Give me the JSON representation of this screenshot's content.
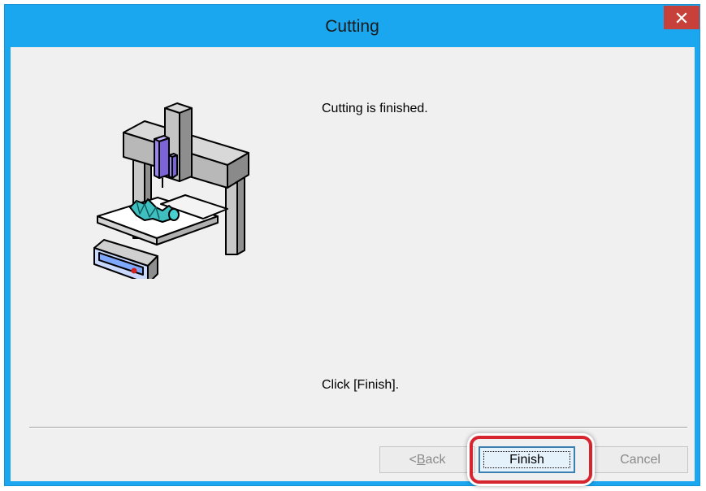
{
  "window": {
    "title": "Cutting",
    "close_label": "✕"
  },
  "content": {
    "message_top": "Cutting is finished.",
    "message_bottom": "Click [Finish]."
  },
  "buttons": {
    "back_prefix": "< ",
    "back_mnemonic": "B",
    "back_rest": "ack",
    "finish": "Finish",
    "cancel": "Cancel"
  },
  "colors": {
    "titlebar": "#1aa7f0",
    "close": "#c7413a",
    "highlight": "#d6252e"
  }
}
